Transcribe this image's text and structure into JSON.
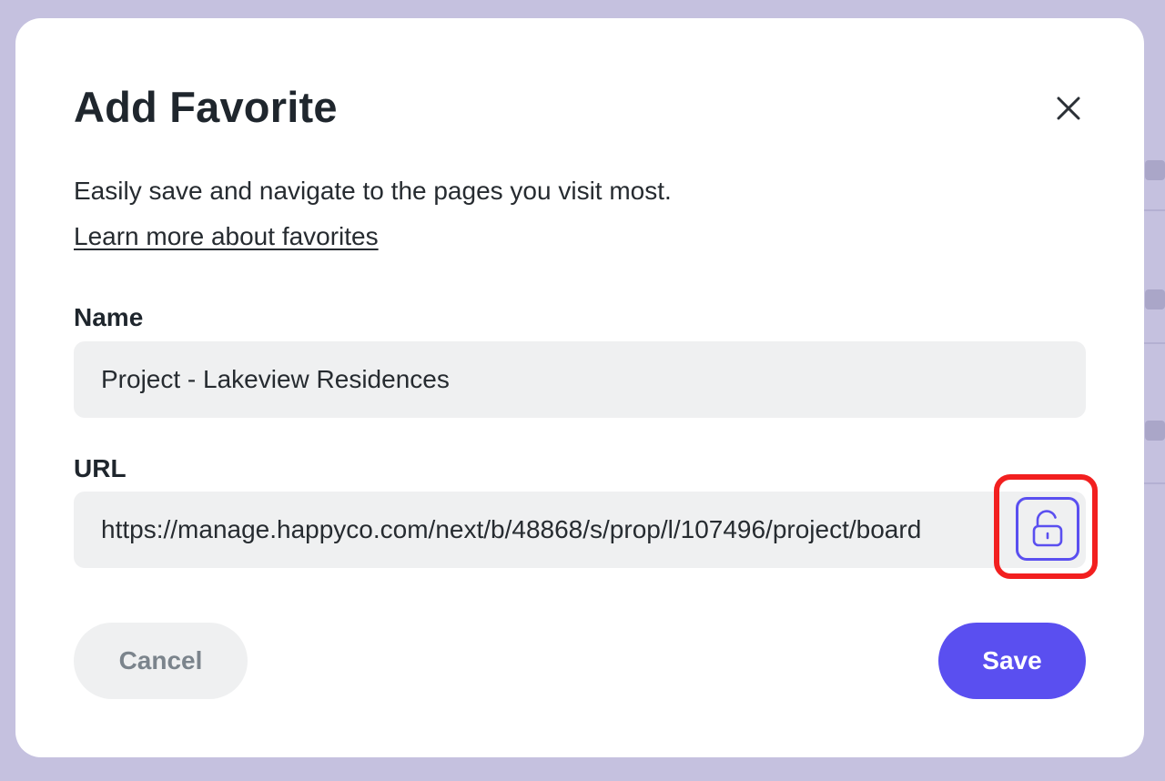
{
  "dialog": {
    "title": "Add Favorite",
    "description": "Easily save and navigate to the pages you visit most.",
    "learn_more_link": "Learn more about favorites",
    "close_icon": "close-icon"
  },
  "form": {
    "name": {
      "label": "Name",
      "value": "Project - Lakeview Residences"
    },
    "url": {
      "label": "URL",
      "value": "https://manage.happyco.com/next/b/48868/s/prop/l/107496/project/board",
      "lock_icon": "unlock-icon",
      "lock_highlighted": true
    }
  },
  "actions": {
    "cancel_label": "Cancel",
    "save_label": "Save"
  },
  "colors": {
    "accent": "#5a4ff0",
    "highlight": "#f21f1f",
    "overlay": "#c5c1df",
    "input_bg": "#eff0f1"
  }
}
